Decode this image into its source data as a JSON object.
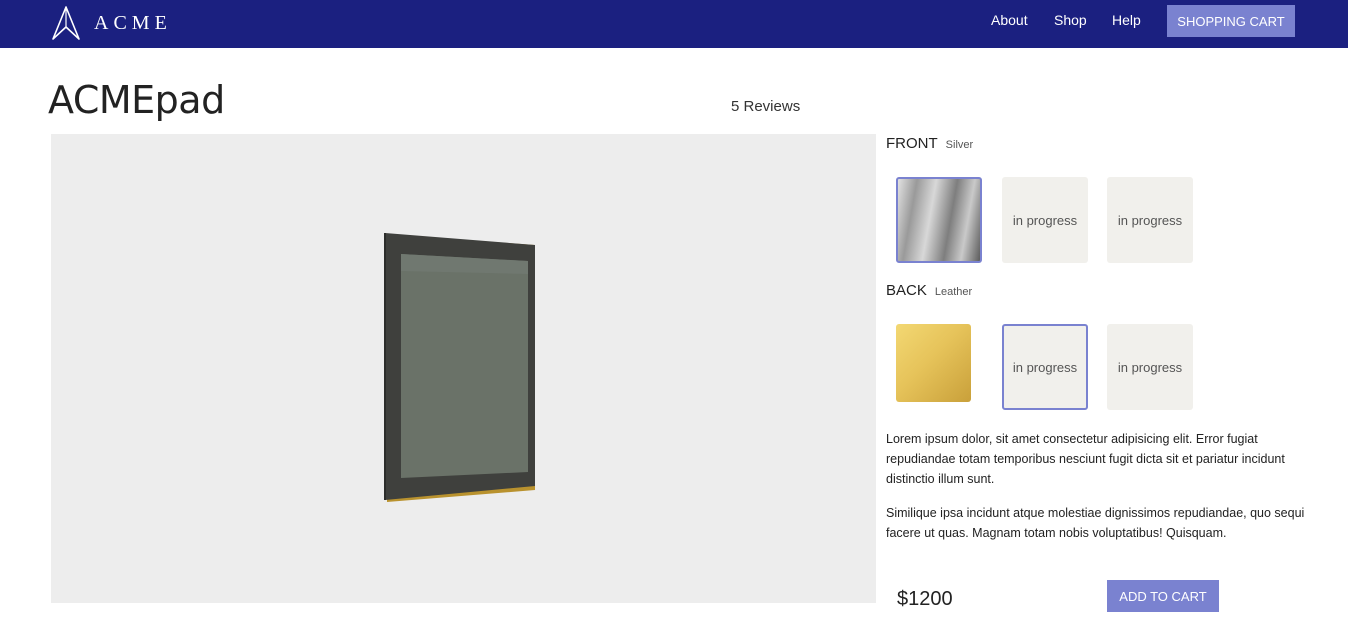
{
  "brand": {
    "name": "ACME",
    "icon": "acme-logo-icon"
  },
  "nav": {
    "links": [
      "About",
      "Shop",
      "Help"
    ],
    "cart_label": "SHOPPING CART"
  },
  "product": {
    "title": "ACMEpad",
    "reviews": "5 Reviews",
    "price": "$1200",
    "add_to_cart_label": "ADD TO CART",
    "description": [
      "Lorem ipsum dolor, sit amet consectetur adipisicing elit. Error fugiat repudiandae totam temporibus nesciunt fugit dicta sit et pariatur incidunt distinctio illum sunt.",
      "Similique ipsa incidunt atque molestiae dignissimos repudiandae, quo sequi facere ut quas. Magnam totam nobis voluptatibus! Quisquam."
    ]
  },
  "options": {
    "front": {
      "label": "FRONT",
      "selected_name": "Silver",
      "swatches": [
        {
          "kind": "material",
          "material": "silver",
          "selected": true
        },
        {
          "kind": "placeholder",
          "text": "in progress",
          "selected": false
        },
        {
          "kind": "placeholder",
          "text": "in progress",
          "selected": false
        }
      ]
    },
    "back": {
      "label": "BACK",
      "selected_name": "Leather",
      "swatches": [
        {
          "kind": "material",
          "material": "gold",
          "selected": false
        },
        {
          "kind": "placeholder",
          "text": "in progress",
          "selected": true
        },
        {
          "kind": "placeholder",
          "text": "in progress",
          "selected": false
        }
      ]
    }
  },
  "colors": {
    "navbar": "#1b2080",
    "accent": "#7a82d0",
    "viewer_bg": "#ededed",
    "swatch_bg": "#f1f0ec"
  }
}
